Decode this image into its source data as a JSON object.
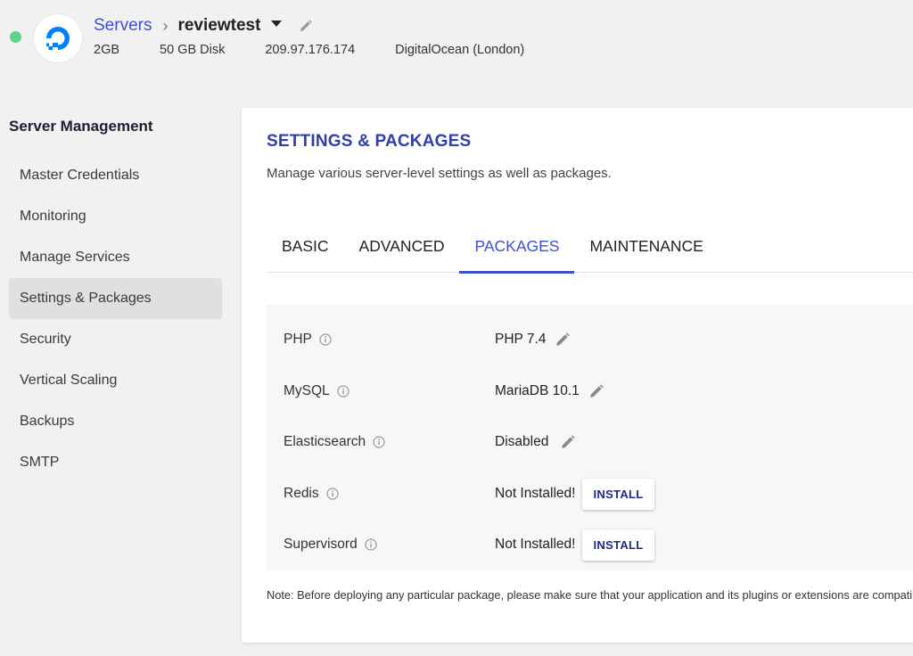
{
  "header": {
    "status_color": "#5fd38d",
    "logo_icon": "digitalocean-logo-icon",
    "breadcrumb_root": "Servers",
    "breadcrumb_current": "reviewtest",
    "ram": "2GB",
    "disk": "50 GB Disk",
    "ip": "209.97.176.174",
    "provider": "DigitalOcean (London)"
  },
  "sidebar": {
    "title": "Server Management",
    "items": [
      {
        "label": "Master Credentials"
      },
      {
        "label": "Monitoring"
      },
      {
        "label": "Manage Services"
      },
      {
        "label": "Settings & Packages",
        "active": true
      },
      {
        "label": "Security"
      },
      {
        "label": "Vertical Scaling"
      },
      {
        "label": "Backups"
      },
      {
        "label": "SMTP"
      }
    ]
  },
  "main": {
    "title": "SETTINGS & PACKAGES",
    "description": "Manage various server-level settings as well as packages.",
    "tabs": [
      {
        "label": "BASIC"
      },
      {
        "label": "ADVANCED"
      },
      {
        "label": "PACKAGES",
        "active": true
      },
      {
        "label": "MAINTENANCE"
      }
    ],
    "packages": [
      {
        "name": "PHP",
        "value": "PHP 7.4",
        "action": "edit"
      },
      {
        "name": "MySQL",
        "value": "MariaDB 10.1",
        "action": "edit"
      },
      {
        "name": "Elasticsearch",
        "value": "Disabled",
        "action": "edit"
      },
      {
        "name": "Redis",
        "value": "Not Installed!",
        "action": "install",
        "button": "INSTALL"
      },
      {
        "name": "Supervisord",
        "value": "Not Installed!",
        "action": "install",
        "button": "INSTALL"
      }
    ],
    "note": "Note: Before deploying any particular package, please make sure that your application and its plugins or extensions are compatible with it."
  },
  "colors": {
    "accent": "#3f4fd0",
    "title": "#2f3fae",
    "button_text": "#1d2a8a"
  }
}
